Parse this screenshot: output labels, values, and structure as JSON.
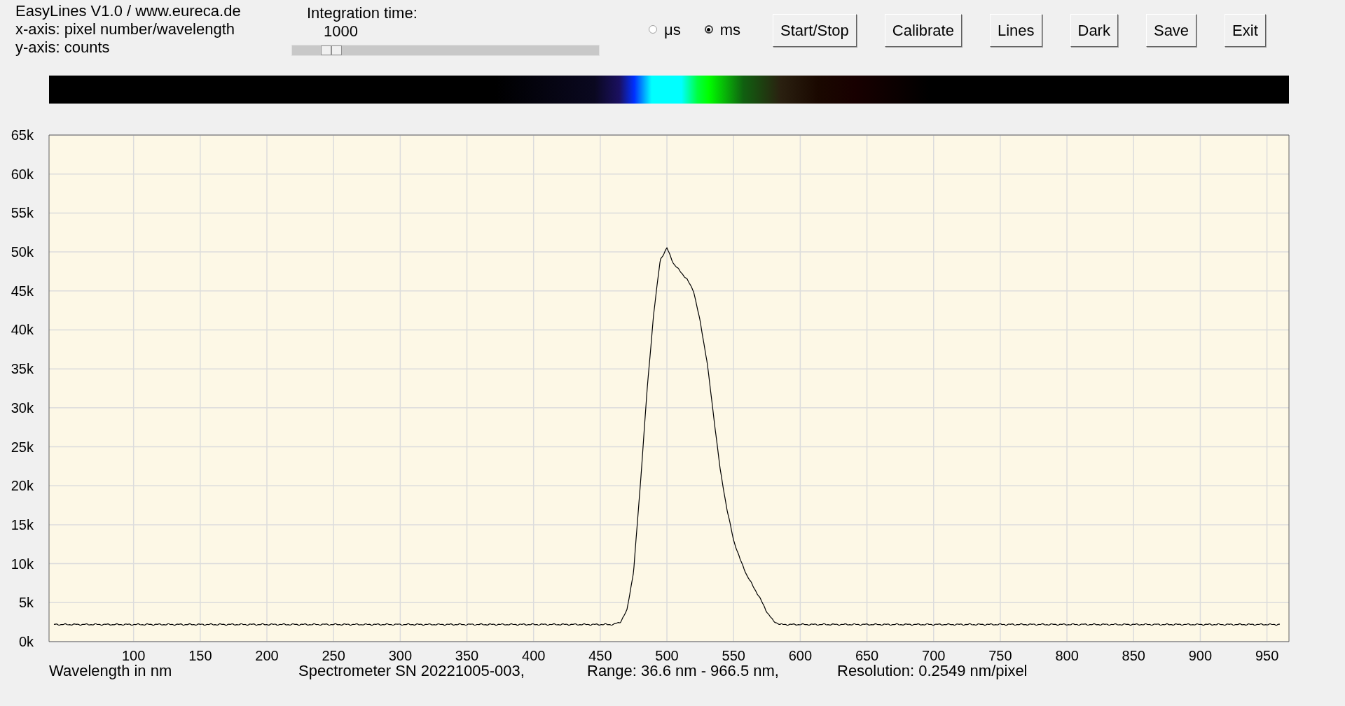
{
  "header": {
    "lines": [
      "EasyLines V1.0 / www.eureca.de",
      "x-axis: pixel number/wavelength",
      "y-axis: counts"
    ]
  },
  "integration": {
    "label": "Integration time:",
    "value": "1000",
    "slider": {
      "level": 0.1
    }
  },
  "units": [
    {
      "label": "μs",
      "selected": false
    },
    {
      "label": "ms",
      "selected": true
    }
  ],
  "buttons": [
    "Start/Stop",
    "Calibrate",
    "Lines",
    "Dark",
    "Save",
    "Exit"
  ],
  "chart": {
    "chart_data": {
      "type": "line",
      "grid": true,
      "xlabel": "Wavelength in nm",
      "xlim": [
        36.6,
        966.5
      ],
      "ylim": [
        0,
        65000
      ],
      "xticks": [
        100,
        150,
        200,
        250,
        300,
        350,
        400,
        450,
        500,
        550,
        600,
        650,
        700,
        750,
        800,
        850,
        900,
        950
      ],
      "yticks": [
        {
          "value": 0,
          "label": "0k"
        },
        {
          "value": 5000,
          "label": "5k"
        },
        {
          "value": 10000,
          "label": "10k"
        },
        {
          "value": 15000,
          "label": "15k"
        },
        {
          "value": 20000,
          "label": "20k"
        },
        {
          "value": 25000,
          "label": "25k"
        },
        {
          "value": 30000,
          "label": "30k"
        },
        {
          "value": 35000,
          "label": "35k"
        },
        {
          "value": 40000,
          "label": "40k"
        },
        {
          "value": 45000,
          "label": "45k"
        },
        {
          "value": 50000,
          "label": "50k"
        },
        {
          "value": 55000,
          "label": "55k"
        },
        {
          "value": 60000,
          "label": "60k"
        },
        {
          "value": 65000,
          "label": "65k"
        }
      ],
      "x": [
        40,
        50,
        60,
        70,
        80,
        90,
        100,
        110,
        120,
        130,
        140,
        150,
        160,
        170,
        180,
        190,
        200,
        210,
        220,
        230,
        240,
        250,
        260,
        270,
        280,
        290,
        300,
        310,
        320,
        330,
        340,
        350,
        360,
        370,
        380,
        390,
        400,
        410,
        420,
        430,
        440,
        450,
        460,
        465,
        470,
        475,
        480,
        485,
        490,
        495,
        500,
        505,
        510,
        515,
        520,
        525,
        530,
        535,
        540,
        545,
        550,
        555,
        560,
        565,
        570,
        575,
        580,
        585,
        590,
        600,
        610,
        620,
        630,
        640,
        650,
        660,
        670,
        680,
        690,
        700,
        710,
        720,
        730,
        740,
        750,
        760,
        770,
        780,
        790,
        800,
        810,
        820,
        830,
        840,
        850,
        860,
        870,
        880,
        890,
        900,
        910,
        920,
        930,
        940,
        950,
        960
      ],
      "series": [
        {
          "color": "#000000",
          "values": [
            2200,
            2200,
            2200,
            2200,
            2200,
            2200,
            2200,
            2200,
            2200,
            2200,
            2200,
            2200,
            2200,
            2200,
            2200,
            2200,
            2200,
            2200,
            2200,
            2200,
            2200,
            2200,
            2200,
            2200,
            2200,
            2200,
            2200,
            2200,
            2200,
            2200,
            2200,
            2200,
            2200,
            2200,
            2200,
            2200,
            2200,
            2200,
            2200,
            2200,
            2200,
            2200,
            2200,
            2500,
            4000,
            9000,
            20000,
            32000,
            42000,
            49000,
            50500,
            48500,
            47500,
            46500,
            45000,
            41000,
            36000,
            29000,
            22000,
            17000,
            13000,
            10500,
            8500,
            7000,
            5500,
            3800,
            2600,
            2200,
            2200,
            2200,
            2200,
            2200,
            2200,
            2200,
            2200,
            2200,
            2200,
            2200,
            2200,
            2200,
            2200,
            2200,
            2200,
            2200,
            2200,
            2200,
            2200,
            2200,
            2200,
            2200,
            2200,
            2200,
            2200,
            2200,
            2200,
            2200,
            2200,
            2200,
            2200,
            2200,
            2200,
            2200,
            2200,
            2200,
            2200,
            2200
          ]
        }
      ]
    }
  },
  "status_bar": [
    "Spectrometer SN 20221005-003,",
    "Range: 36.6 nm - 966.5 nm,",
    "Resolution: 0.2549 nm/pixel"
  ]
}
